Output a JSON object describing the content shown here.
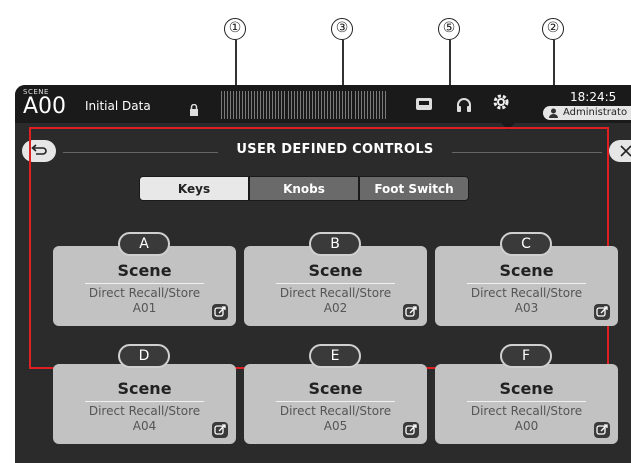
{
  "callouts": [
    "①",
    "③",
    "⑤",
    "②"
  ],
  "header": {
    "scene_small": "SCENE",
    "scene_number": "A00",
    "scene_name": "Initial Data",
    "time": "18:24:5",
    "user": "Administrato"
  },
  "panel": {
    "title": "USER DEFINED CONTROLS"
  },
  "tabs": [
    {
      "label": "Keys",
      "active": true
    },
    {
      "label": "Knobs",
      "active": false
    },
    {
      "label": "Foot Switch",
      "active": false
    }
  ],
  "keys": [
    {
      "letter": "A",
      "title": "Scene",
      "function": "Direct Recall/Store",
      "value": "A01"
    },
    {
      "letter": "B",
      "title": "Scene",
      "function": "Direct Recall/Store",
      "value": "A02"
    },
    {
      "letter": "C",
      "title": "Scene",
      "function": "Direct Recall/Store",
      "value": "A03"
    },
    {
      "letter": "D",
      "title": "Scene",
      "function": "Direct Recall/Store",
      "value": "A04"
    },
    {
      "letter": "E",
      "title": "Scene",
      "function": "Direct Recall/Store",
      "value": "A05"
    },
    {
      "letter": "F",
      "title": "Scene",
      "function": "Direct Recall/Store",
      "value": "A00"
    }
  ],
  "colors": {
    "highlight": "#e02020",
    "background": "#2b2b2b",
    "card": "#c2c2c2"
  },
  "icons": [
    "lock-icon",
    "back-icon",
    "close-icon",
    "recorder-icon",
    "headphones-icon",
    "gear-icon",
    "user-icon",
    "edit-icon"
  ]
}
